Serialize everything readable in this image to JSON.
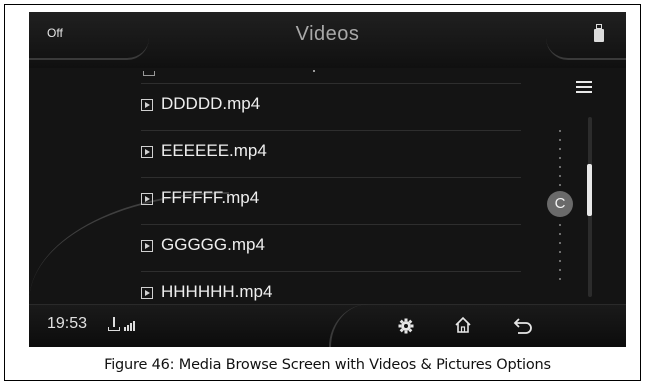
{
  "header": {
    "off_label": "Off",
    "title": "Videos",
    "source_icon": "usb-drive-icon"
  },
  "file_list": {
    "items": [
      {
        "icon": "video-file-icon",
        "name": "DDDDD.mp4"
      },
      {
        "icon": "video-file-icon",
        "name": "EEEEEE.mp4"
      },
      {
        "icon": "video-file-icon",
        "name": "FFFFFF.mp4"
      },
      {
        "icon": "video-file-icon",
        "name": "GGGGG.mp4"
      },
      {
        "icon": "video-file-icon",
        "name": "HHHHHH.mp4"
      }
    ]
  },
  "sidebar": {
    "list_view_icon": "list-view-icon",
    "index_letter": "C",
    "scroll_position": 0.3
  },
  "status_bar": {
    "time": "19:53",
    "usb_icon": "usb-icon",
    "signal_icon": "signal-bars-icon",
    "settings_icon": "gear-icon",
    "home_icon": "home-icon",
    "back_icon": "back-arrow-icon"
  },
  "caption": "Figure 46: Media Browse Screen with Videos & Pictures Options",
  "colors": {
    "screen_bg": "#141414",
    "text": "#eeeeee",
    "title_text": "#a8a8a8"
  }
}
